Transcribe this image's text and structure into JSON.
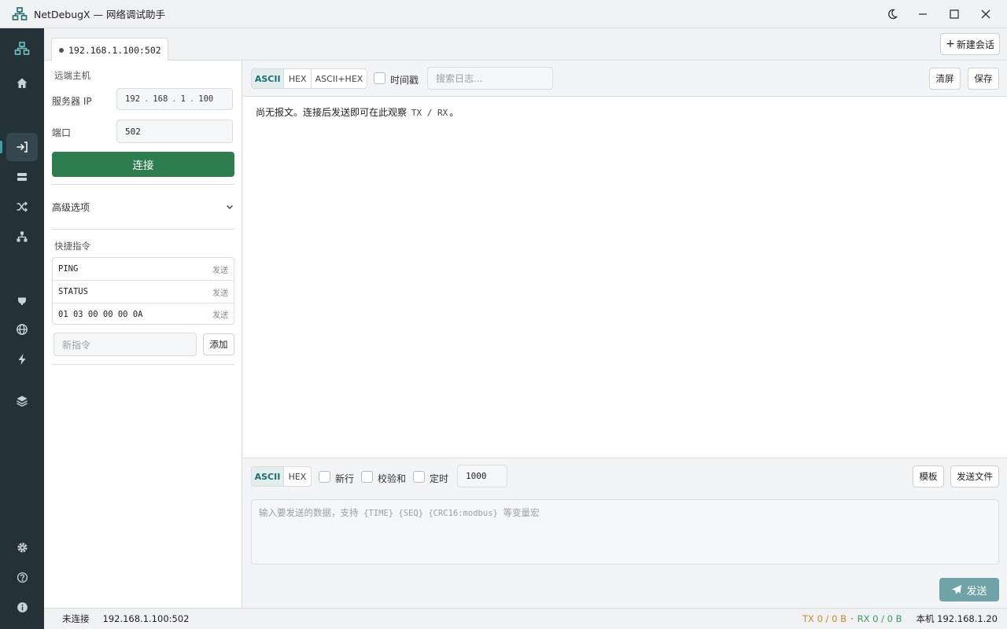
{
  "window": {
    "title": "NetDebugX — 网络调试助手"
  },
  "tabs": [
    {
      "label": "192.168.1.100:502"
    }
  ],
  "new_session_label": "新建会话",
  "remote": {
    "section_label": "远端主机",
    "server_ip_label": "服务器 IP",
    "ip": [
      "192",
      "168",
      "1",
      "100"
    ],
    "port_label": "端口",
    "port_value": "502",
    "connect_label": "连接",
    "connect_color": "#2e7d4f"
  },
  "advanced": {
    "label": "高级选项"
  },
  "quick": {
    "section_label": "快捷指令",
    "items": [
      {
        "text": "PING",
        "send": "发送"
      },
      {
        "text": "STATUS",
        "send": "发送"
      },
      {
        "text": "01 03 00 00 00 0A",
        "send": "发送"
      }
    ],
    "new_placeholder": "新指令",
    "add_label": "添加"
  },
  "log": {
    "modes": [
      "ASCII",
      "HEX",
      "ASCII+HEX"
    ],
    "active_mode": "ASCII",
    "timestamp_label": "时间戳",
    "search_placeholder": "搜索日志...",
    "clear_label": "清屏",
    "save_label": "保存",
    "empty_text": "尚无报文。连接后发送即可在此观察",
    "empty_tx_rx": "TX / RX",
    "empty_end": "。"
  },
  "send": {
    "modes": [
      "ASCII",
      "HEX"
    ],
    "active_mode": "ASCII",
    "newline_label": "新行",
    "checksum_label": "校验和",
    "timer_label": "定时",
    "timer_value": "1000",
    "template_label": "模板",
    "send_file_label": "发送文件",
    "placeholder_prefix": "输入要发送的数据，支持",
    "placeholder_macros": "{TIME} {SEQ} {CRC16:modbus}",
    "placeholder_suffix": "等变量宏",
    "send_label": "发送",
    "send_color": "#6fa3a8"
  },
  "status": {
    "state": "未连接",
    "address": "192.168.1.100:502",
    "tx": "TX 0 / 0 B",
    "sep": "·",
    "rx": "RX 0 / 0 B",
    "local": "本机 192.168.1.20",
    "tx_color": "#c98a2b",
    "rx_color": "#3a9a5a"
  },
  "icons": {
    "sidebar": [
      "network-icon",
      "home-icon",
      "login-icon",
      "server-icon",
      "shuffle-icon",
      "sitemap-icon",
      "plug-icon",
      "globe-icon",
      "bolt-icon",
      "layers-icon",
      "gear-icon",
      "help-icon",
      "info-icon"
    ]
  }
}
